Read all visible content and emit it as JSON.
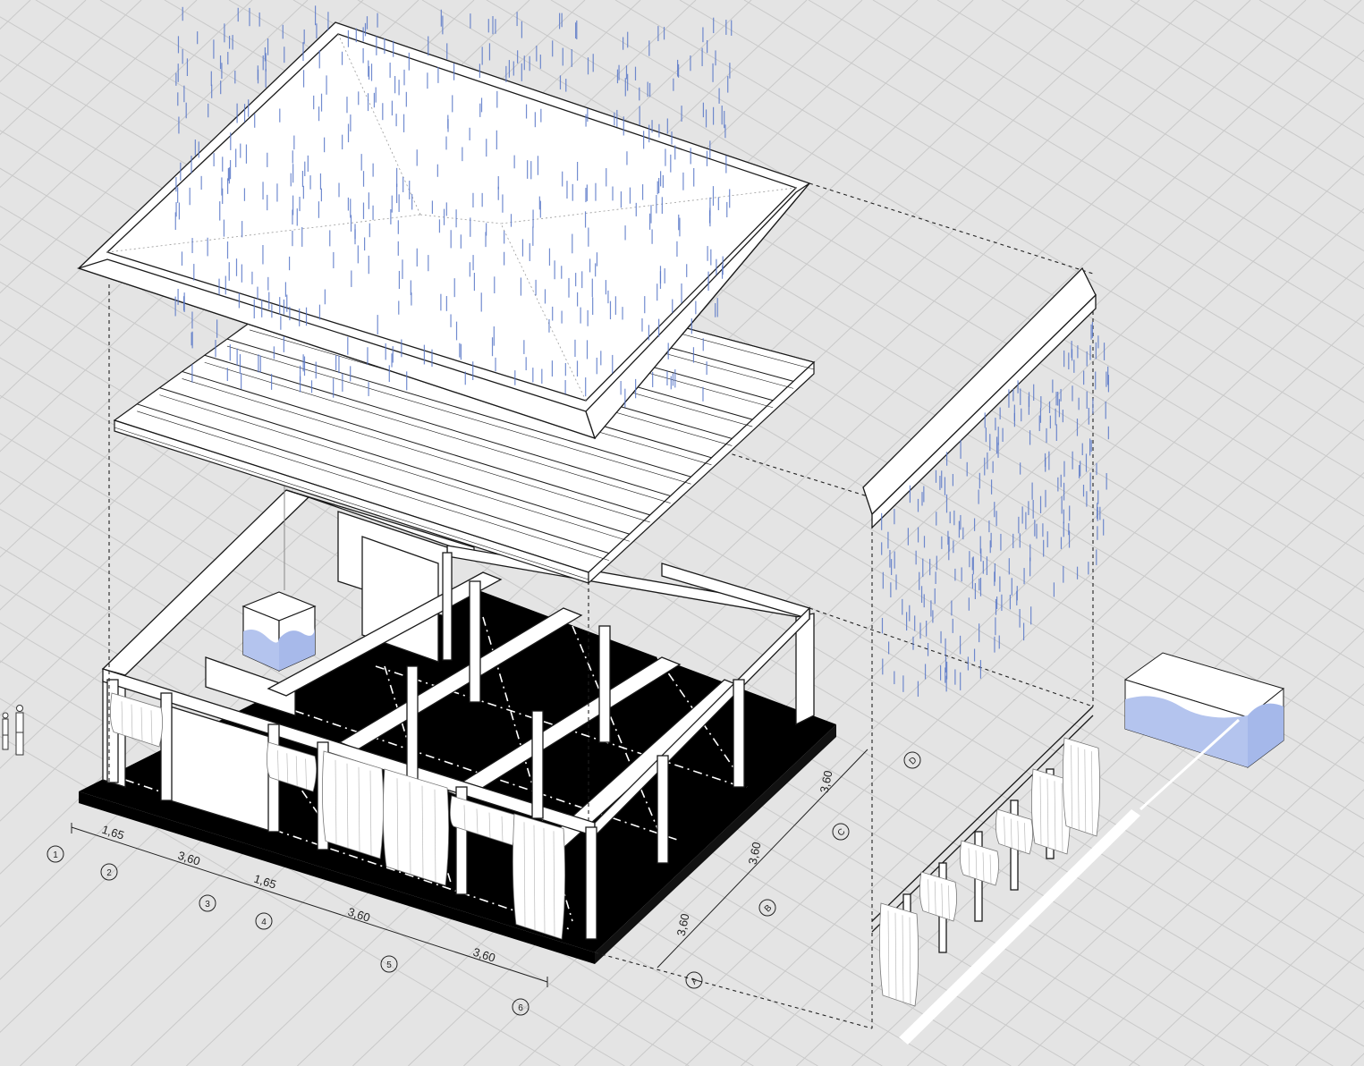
{
  "drawing": {
    "column_axes": [
      {
        "label": "1"
      },
      {
        "label": "2"
      },
      {
        "label": "3"
      },
      {
        "label": "4"
      },
      {
        "label": "5"
      },
      {
        "label": "6"
      }
    ],
    "column_dimensions": [
      {
        "text": "1,65"
      },
      {
        "text": "3,60"
      },
      {
        "text": "1,65"
      },
      {
        "text": "3,60"
      },
      {
        "text": "3,60"
      }
    ],
    "row_axes": [
      {
        "label": "A"
      },
      {
        "label": "B"
      },
      {
        "label": "C"
      },
      {
        "label": "D"
      }
    ],
    "row_dimensions": [
      {
        "text": "3,60"
      },
      {
        "text": "3,60"
      },
      {
        "text": "3,60"
      }
    ],
    "colors": {
      "background": "#e4e4e4",
      "grid_line": "#c9c9c9",
      "structure": "#ffffff",
      "outline": "#1a1a1a",
      "floor_slab": "#000000",
      "rain": "#5a78c8",
      "water": "#b4c4ee"
    }
  }
}
